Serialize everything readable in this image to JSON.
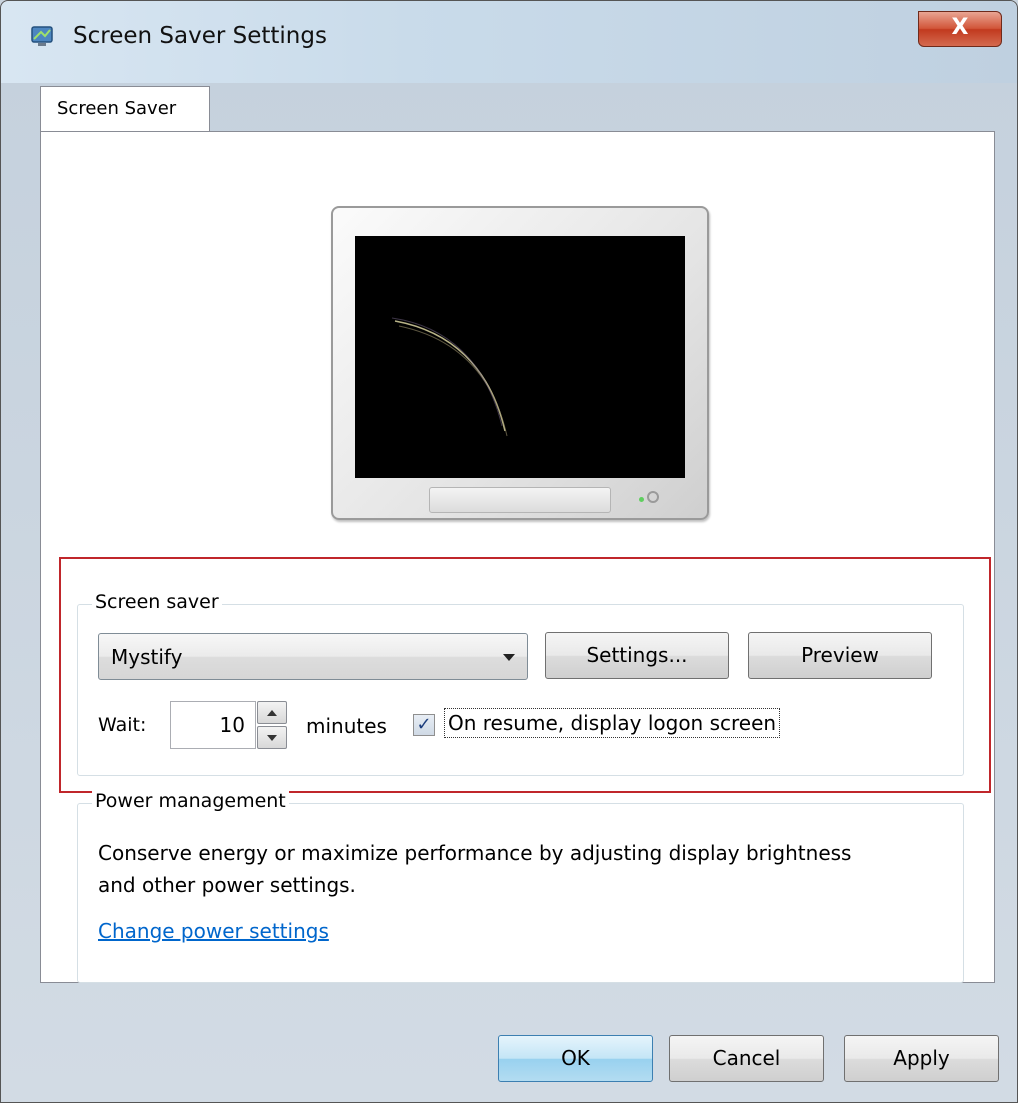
{
  "window": {
    "title": "Screen Saver Settings",
    "close_label": "X"
  },
  "tabs": [
    {
      "label": "Screen Saver",
      "selected": true
    }
  ],
  "screen_saver_group": {
    "legend": "Screen saver",
    "selected_saver": "Mystify",
    "settings_button": "Settings...",
    "preview_button": "Preview",
    "wait_label": "Wait:",
    "wait_value": "10",
    "minutes_label": "minutes",
    "resume_checkbox_label": "On resume, display logon screen",
    "resume_checked": true
  },
  "power_group": {
    "legend": "Power management",
    "description": "Conserve energy or maximize performance by adjusting display brightness and other power settings.",
    "link_label": "Change power settings"
  },
  "footer": {
    "ok": "OK",
    "cancel": "Cancel",
    "apply": "Apply"
  },
  "colors": {
    "highlight_border": "#c0262b",
    "link": "#0066cc",
    "close_button": "#c23a1f"
  },
  "icons": {
    "app": "screen-saver-app-icon",
    "dropdown": "chevron-down-icon",
    "spin_up": "arrow-up-icon",
    "spin_down": "arrow-down-icon",
    "check": "checkmark-icon"
  }
}
